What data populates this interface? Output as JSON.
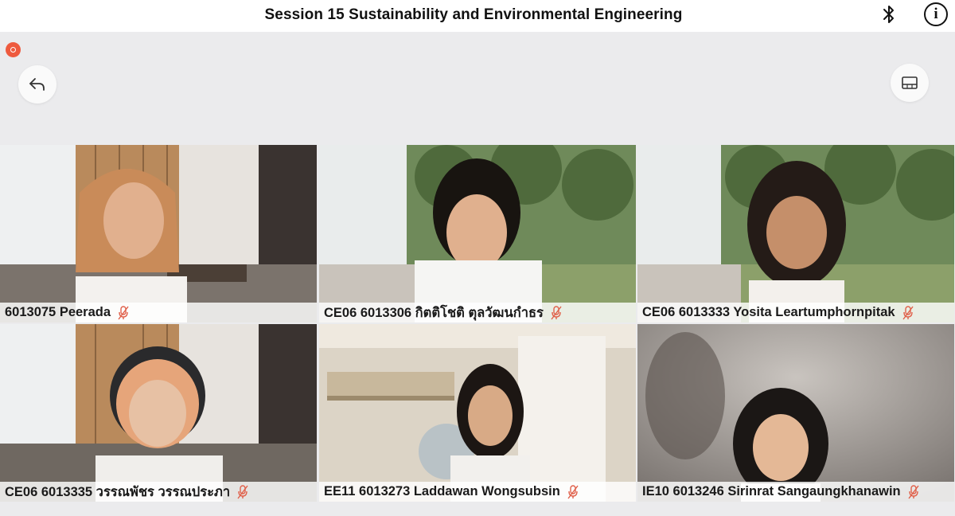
{
  "header": {
    "title": "Session 15 Sustainability and Environmental Engineering",
    "icons": [
      "bluetooth-icon",
      "info-icon"
    ]
  },
  "toolbar": {
    "recording_indicator_color": "#ee5a3e",
    "back_icon": "back-arrow-icon",
    "layout_icon": "layout-toggle-icon"
  },
  "participants": [
    {
      "name": "6013075 Peerada",
      "muted": true,
      "background": "office"
    },
    {
      "name": "CE06 6013306 กิตติโชติ ตุลวัฒนกำธร",
      "muted": true,
      "background": "park"
    },
    {
      "name": "CE06 6013333 Yosita Leartumphornpitak",
      "muted": true,
      "background": "park"
    },
    {
      "name": "CE06 6013335 วรรณพัชร วรรณประภา",
      "muted": true,
      "background": "office"
    },
    {
      "name": "EE11 6013273 Laddawan Wongsubsin",
      "muted": true,
      "background": "room"
    },
    {
      "name": "IE10 6013246 Sirinrat Sangaungkhanawin",
      "muted": true,
      "background": "blur"
    }
  ],
  "colors": {
    "muted_icon": "#e0604a",
    "page_background": "#ebebed"
  }
}
